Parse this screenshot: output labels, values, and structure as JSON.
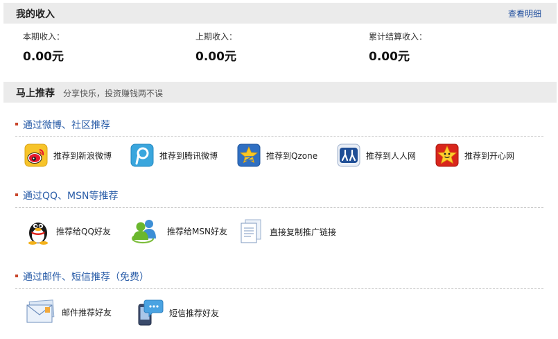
{
  "income": {
    "title": "我的收入",
    "details_link": "查看明细",
    "stats": [
      {
        "label": "本期收入：",
        "value": "0.00元"
      },
      {
        "label": "上期收入：",
        "value": "0.00元"
      },
      {
        "label": "累计结算收入：",
        "value": "0.00元"
      }
    ]
  },
  "recommend": {
    "title": "马上推荐",
    "subtitle": "分享快乐，投资赚钱两不误",
    "sections": [
      {
        "title": "通过微博、社区推荐",
        "items": [
          {
            "label": "推荐到新浪微博",
            "icon": "sina-weibo-icon"
          },
          {
            "label": "推荐到腾讯微博",
            "icon": "tencent-weibo-icon"
          },
          {
            "label": "推荐到Qzone",
            "icon": "qzone-icon"
          },
          {
            "label": "推荐到人人网",
            "icon": "renren-icon"
          },
          {
            "label": "推荐到开心网",
            "icon": "kaixin-icon"
          }
        ]
      },
      {
        "title": "通过QQ、MSN等推荐",
        "items": [
          {
            "label": "推荐给QQ好友",
            "icon": "qq-penguin-icon"
          },
          {
            "label": "推荐给MSN好友",
            "icon": "msn-icon"
          },
          {
            "label": "直接复制推广链接",
            "icon": "copy-document-icon"
          }
        ]
      },
      {
        "title": "通过邮件、短信推荐（免费）",
        "items": [
          {
            "label": "邮件推荐好友",
            "icon": "email-envelope-icon"
          },
          {
            "label": "短信推荐好友",
            "icon": "sms-phone-icon"
          }
        ]
      }
    ]
  },
  "colors": {
    "header_bg": "#ebebeb",
    "section_title": "#2a5da8",
    "bullet": "#c8452a",
    "link": "#1f4e9e"
  }
}
